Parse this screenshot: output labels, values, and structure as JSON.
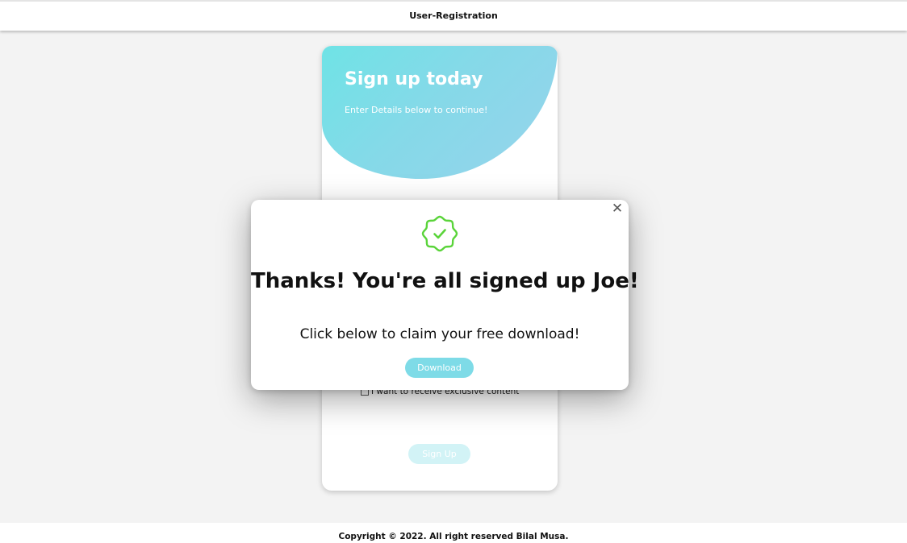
{
  "header": {
    "title": "User-Registration"
  },
  "signup_card": {
    "heading": "Sign up today",
    "subheading": "Enter Details below to continue!",
    "consent_label": "I want to receive exclusive content",
    "consent_checked": false,
    "signup_button_label": "Sign Up"
  },
  "modal": {
    "badge_icon": "verified-check-icon",
    "close_icon": "close-icon",
    "title": "Thanks! You're all signed up Joe!",
    "message": "Click below to claim your free download!",
    "download_button_label": "Download"
  },
  "footer": {
    "copyright": "Copyright © 2022. All right reserved Bilal Musa."
  },
  "colors": {
    "accent": "#7edbe7",
    "gradient_start": "#6fe3e6",
    "gradient_end": "#97d3ec",
    "success_green": "#5ad43a",
    "disabled_button": "#d2f3f6"
  }
}
